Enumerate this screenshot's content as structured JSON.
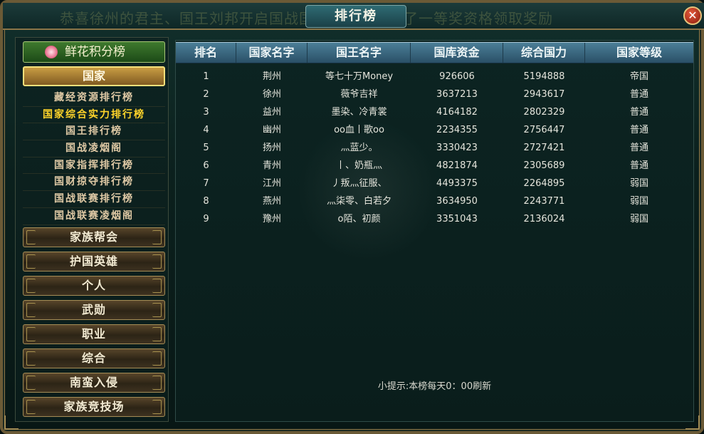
{
  "window": {
    "title": "排行榜",
    "marquee": "恭喜徐州的君主、国王刘邦开启国战国家领地，获得了一等奖资格领取奖励",
    "close_glyph": "✕"
  },
  "sidebar": {
    "flower_button": "鲜花积分榜",
    "country_button": "国家",
    "submenu": [
      {
        "label": "藏经资源排行榜",
        "active": false
      },
      {
        "label": "国家综合实力排行榜",
        "active": true
      },
      {
        "label": "国王排行榜",
        "active": false
      },
      {
        "label": "国战凌烟阁",
        "active": false
      },
      {
        "label": "国家指挥排行榜",
        "active": false
      },
      {
        "label": "国财掠夺排行榜",
        "active": false
      },
      {
        "label": "国战联赛排行榜",
        "active": false
      },
      {
        "label": "国战联赛凌烟阁",
        "active": false
      }
    ],
    "nav_buttons": [
      "家族帮会",
      "护国英雄",
      "个人",
      "武勋",
      "职业",
      "综合",
      "南蛮入侵",
      "家族竞技场"
    ]
  },
  "table": {
    "columns": [
      "排名",
      "国家名字",
      "国王名字",
      "国库资金",
      "综合国力",
      "国家等级"
    ],
    "rows": [
      [
        "1",
        "荆州",
        "等七十万Money",
        "926606",
        "5194888",
        "帝国"
      ],
      [
        "2",
        "徐州",
        "薇爷吉祥",
        "3637213",
        "2943617",
        "普通"
      ],
      [
        "3",
        "益州",
        "墨染、冷青裳",
        "4164182",
        "2802329",
        "普通"
      ],
      [
        "4",
        "幽州",
        "oo血丨歌oo",
        "2234355",
        "2756447",
        "普通"
      ],
      [
        "5",
        "扬州",
        "灬蓝少。",
        "3330423",
        "2727421",
        "普通"
      ],
      [
        "6",
        "青州",
        "丨、奶瓶灬",
        "4821874",
        "2305689",
        "普通"
      ],
      [
        "7",
        "江州",
        "丿叛灬征服、",
        "4493375",
        "2264895",
        "弱国"
      ],
      [
        "8",
        "燕州",
        "灬柒零、白若夕",
        "3634950",
        "2243771",
        "弱国"
      ],
      [
        "9",
        "豫州",
        "o陌、初颜",
        "3351043",
        "2136024",
        "弱国"
      ]
    ]
  },
  "tip": "小提示:本榜每天0：00刷新",
  "colors": {
    "accent": "#ffd42a",
    "header_blue": "#4b7e97",
    "frame_gold": "#a48c55"
  }
}
